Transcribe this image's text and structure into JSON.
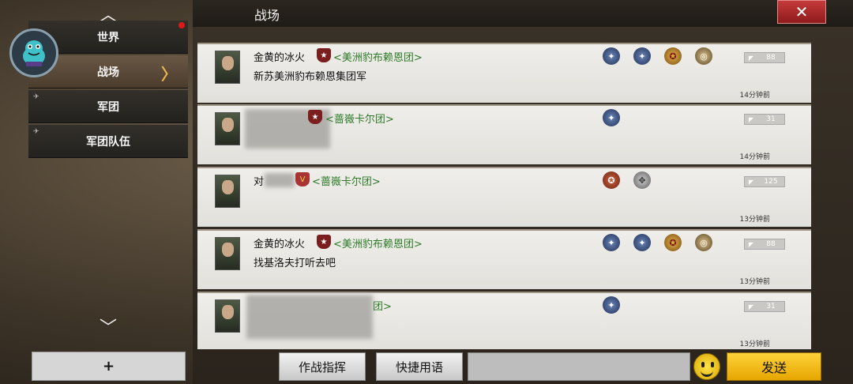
{
  "window": {
    "title": "战场",
    "close_label": "✕"
  },
  "sidebar": {
    "up_arrow": "︿",
    "down_arrow": "﹀",
    "items": [
      {
        "label": "世界",
        "has_notification": true
      },
      {
        "label": "战场",
        "active": true,
        "chevron": "〉"
      },
      {
        "label": "军团"
      },
      {
        "label": "军团队伍"
      }
    ],
    "add_label": "+"
  },
  "messages": [
    {
      "player": "金黄的冰火",
      "legion": "<美洲豹布赖恩团>",
      "text": "新苏美洲豹布赖恩集团军",
      "likes": "88",
      "time": "14分钟前",
      "badges": [
        "blue",
        "blue",
        "gold",
        "bronze"
      ]
    },
    {
      "player": "",
      "legion": "<蔷嶶卡尔团>",
      "text": "",
      "likes": "31",
      "time": "14分钟前",
      "badges": [
        "blue"
      ]
    },
    {
      "player": "对",
      "legion": "<蔷嶶卡尔团>",
      "text": "",
      "likes": "125",
      "time": "13分钟前",
      "badges": [
        "red",
        "gray"
      ]
    },
    {
      "player": "金黄的冰火",
      "legion": "<美洲豹布赖恩团>",
      "text": "找基洛夫打听去吧",
      "likes": "88",
      "time": "13分钟前",
      "badges": [
        "blue",
        "blue",
        "gold",
        "bronze"
      ]
    },
    {
      "player": "",
      "legion": "团>",
      "text": "",
      "likes": "31",
      "time": "13分钟前",
      "badges": [
        "blue"
      ]
    }
  ],
  "bottom": {
    "command_label": "作战指挥",
    "phrase_label": "快捷用语",
    "input_value": "",
    "send_label": "发送"
  }
}
